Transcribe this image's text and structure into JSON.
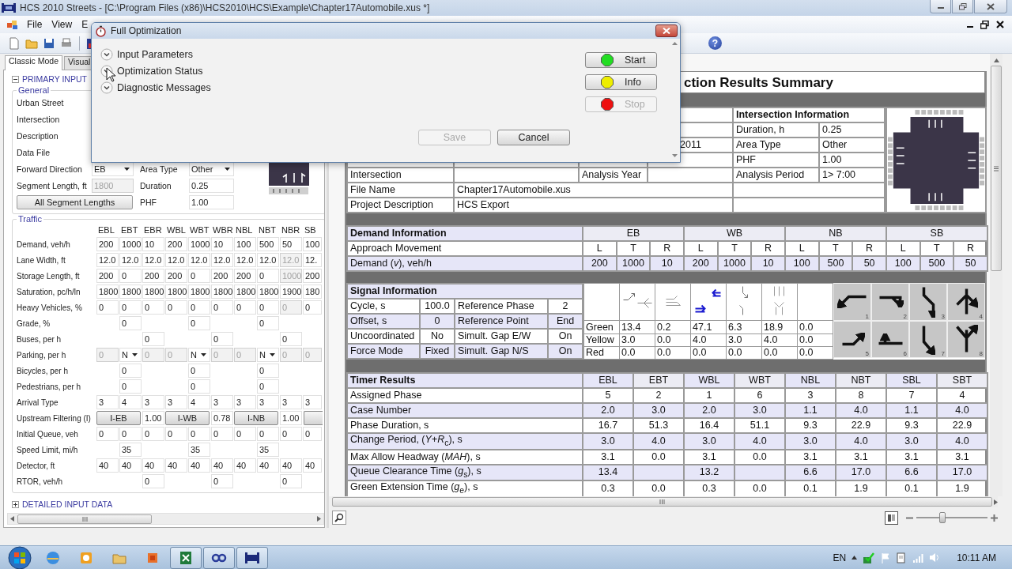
{
  "window": {
    "title": "HCS 2010 Streets - [C:\\Program Files (x86)\\HCS2010\\HCS\\Example\\Chapter17Automobile.xus *]"
  },
  "menu": [
    "File",
    "View",
    "E"
  ],
  "toolbar": {
    "help_glyph": "?"
  },
  "left_panel": {
    "tabs": [
      {
        "label": "Classic Mode",
        "selected": true
      },
      {
        "label": "Visual",
        "selected": false
      }
    ],
    "primary_input": {
      "label": "PRIMARY INPUT",
      "expanded": true
    },
    "general": {
      "legend": "General",
      "labels": [
        "Urban Street",
        "Intersection",
        "Description",
        "Data File"
      ],
      "forward_direction": {
        "label": "Forward Direction",
        "value": "EB"
      },
      "area_type": {
        "label": "Area Type",
        "value": "Other"
      },
      "segment_length": {
        "label": "Segment Length, ft",
        "value": "1800",
        "disabled": true
      },
      "duration": {
        "label": "Duration",
        "value": "0.25",
        "disabled": false
      },
      "all_segment_lengths": "All Segment Lengths",
      "phf": {
        "label": "PHF",
        "value": "1.00",
        "disabled": false
      }
    },
    "traffic": {
      "legend": "Traffic",
      "columns": [
        "EBL",
        "EBT",
        "EBR",
        "WBL",
        "WBT",
        "WBR",
        "NBL",
        "NBT",
        "NBR",
        "SB"
      ],
      "rows": [
        {
          "label": "Demand, veh/h",
          "cells": [
            {
              "kind": "input",
              "value": "200",
              "disabled": false
            },
            {
              "kind": "input",
              "value": "1000",
              "disabled": false
            },
            {
              "kind": "input",
              "value": "10",
              "disabled": false
            },
            {
              "kind": "input",
              "value": "200",
              "disabled": false
            },
            {
              "kind": "input",
              "value": "1000",
              "disabled": false
            },
            {
              "kind": "input",
              "value": "10",
              "disabled": false
            },
            {
              "kind": "input",
              "value": "100",
              "disabled": false
            },
            {
              "kind": "input",
              "value": "500",
              "disabled": false
            },
            {
              "kind": "input",
              "value": "50",
              "disabled": false
            },
            {
              "kind": "input",
              "value": "100",
              "disabled": false
            }
          ]
        },
        {
          "label": "Lane Width, ft",
          "cells": [
            {
              "kind": "input",
              "value": "12.0",
              "disabled": false
            },
            {
              "kind": "input",
              "value": "12.0",
              "disabled": false
            },
            {
              "kind": "input",
              "value": "12.0",
              "disabled": false
            },
            {
              "kind": "input",
              "value": "12.0",
              "disabled": false
            },
            {
              "kind": "input",
              "value": "12.0",
              "disabled": false
            },
            {
              "kind": "input",
              "value": "12.0",
              "disabled": false
            },
            {
              "kind": "input",
              "value": "12.0",
              "disabled": false
            },
            {
              "kind": "input",
              "value": "12.0",
              "disabled": false
            },
            {
              "kind": "input",
              "value": "12.0",
              "disabled": true
            },
            {
              "kind": "input",
              "value": "12.",
              "disabled": false
            }
          ]
        },
        {
          "label": "Storage Length, ft",
          "cells": [
            {
              "kind": "input",
              "value": "200",
              "disabled": false
            },
            {
              "kind": "input",
              "value": "0",
              "disabled": false
            },
            {
              "kind": "input",
              "value": "200",
              "disabled": false
            },
            {
              "kind": "input",
              "value": "200",
              "disabled": false
            },
            {
              "kind": "input",
              "value": "0",
              "disabled": false
            },
            {
              "kind": "input",
              "value": "200",
              "disabled": false
            },
            {
              "kind": "input",
              "value": "200",
              "disabled": false
            },
            {
              "kind": "input",
              "value": "0",
              "disabled": false
            },
            {
              "kind": "input",
              "value": "1000",
              "disabled": true
            },
            {
              "kind": "input",
              "value": "200",
              "disabled": false
            }
          ]
        },
        {
          "label": "Saturation, pc/h/ln",
          "cells": [
            {
              "kind": "input",
              "value": "1800",
              "disabled": false
            },
            {
              "kind": "input",
              "value": "1800",
              "disabled": false
            },
            {
              "kind": "input",
              "value": "1800",
              "disabled": false
            },
            {
              "kind": "input",
              "value": "1800",
              "disabled": false
            },
            {
              "kind": "input",
              "value": "1800",
              "disabled": false
            },
            {
              "kind": "input",
              "value": "1800",
              "disabled": false
            },
            {
              "kind": "input",
              "value": "1800",
              "disabled": false
            },
            {
              "kind": "input",
              "value": "1800",
              "disabled": false
            },
            {
              "kind": "input",
              "value": "1900",
              "disabled": false
            },
            {
              "kind": "input",
              "value": "180",
              "disabled": false
            }
          ]
        },
        {
          "label": "Heavy Vehicles, %",
          "cells": [
            {
              "kind": "input",
              "value": "0",
              "disabled": false
            },
            {
              "kind": "input",
              "value": "0",
              "disabled": false
            },
            {
              "kind": "input",
              "value": "0",
              "disabled": false
            },
            {
              "kind": "input",
              "value": "0",
              "disabled": false
            },
            {
              "kind": "input",
              "value": "0",
              "disabled": false
            },
            {
              "kind": "input",
              "value": "0",
              "disabled": false
            },
            {
              "kind": "input",
              "value": "0",
              "disabled": false
            },
            {
              "kind": "input",
              "value": "0",
              "disabled": false
            },
            {
              "kind": "input",
              "value": "0",
              "disabled": true
            },
            {
              "kind": "input",
              "value": "0",
              "disabled": false
            }
          ]
        },
        {
          "label": "Grade, %",
          "cells": [
            {
              "kind": "empty"
            },
            {
              "kind": "input",
              "value": "0",
              "disabled": false
            },
            {
              "kind": "empty"
            },
            {
              "kind": "empty"
            },
            {
              "kind": "input",
              "value": "0",
              "disabled": false
            },
            {
              "kind": "empty"
            },
            {
              "kind": "empty"
            },
            {
              "kind": "input",
              "value": "0",
              "disabled": false
            },
            {
              "kind": "empty"
            },
            {
              "kind": "empty"
            }
          ]
        },
        {
          "label": "Buses, per h",
          "cells": [
            {
              "kind": "empty"
            },
            {
              "kind": "empty"
            },
            {
              "kind": "input",
              "value": "0",
              "disabled": false
            },
            {
              "kind": "empty"
            },
            {
              "kind": "empty"
            },
            {
              "kind": "input",
              "value": "0",
              "disabled": false
            },
            {
              "kind": "empty"
            },
            {
              "kind": "empty"
            },
            {
              "kind": "input",
              "value": "0",
              "disabled": false
            },
            {
              "kind": "empty"
            }
          ]
        },
        {
          "label": "Parking, per h",
          "cells": [
            {
              "kind": "input",
              "value": "0",
              "disabled": true
            },
            {
              "kind": "dropdown",
              "value": "N"
            },
            {
              "kind": "input",
              "value": "0",
              "disabled": true
            },
            {
              "kind": "input",
              "value": "0",
              "disabled": true
            },
            {
              "kind": "dropdown",
              "value": "N"
            },
            {
              "kind": "input",
              "value": "0",
              "disabled": true
            },
            {
              "kind": "input",
              "value": "0",
              "disabled": true
            },
            {
              "kind": "dropdown",
              "value": "N"
            },
            {
              "kind": "input",
              "value": "0",
              "disabled": true
            },
            {
              "kind": "input",
              "value": "0",
              "disabled": true
            }
          ]
        },
        {
          "label": "Bicycles, per h",
          "cells": [
            {
              "kind": "empty"
            },
            {
              "kind": "input",
              "value": "0",
              "disabled": false
            },
            {
              "kind": "empty"
            },
            {
              "kind": "empty"
            },
            {
              "kind": "input",
              "value": "0",
              "disabled": false
            },
            {
              "kind": "empty"
            },
            {
              "kind": "empty"
            },
            {
              "kind": "input",
              "value": "0",
              "disabled": false
            },
            {
              "kind": "empty"
            },
            {
              "kind": "empty"
            }
          ]
        },
        {
          "label": "Pedestrians, per h",
          "cells": [
            {
              "kind": "empty"
            },
            {
              "kind": "input",
              "value": "0",
              "disabled": false
            },
            {
              "kind": "empty"
            },
            {
              "kind": "empty"
            },
            {
              "kind": "input",
              "value": "0",
              "disabled": false
            },
            {
              "kind": "empty"
            },
            {
              "kind": "empty"
            },
            {
              "kind": "input",
              "value": "0",
              "disabled": false
            },
            {
              "kind": "empty"
            },
            {
              "kind": "empty"
            }
          ]
        },
        {
          "label": "Arrival Type",
          "cells": [
            {
              "kind": "input",
              "value": "3",
              "disabled": false
            },
            {
              "kind": "input",
              "value": "4",
              "disabled": false
            },
            {
              "kind": "input",
              "value": "3",
              "disabled": false
            },
            {
              "kind": "input",
              "value": "3",
              "disabled": false
            },
            {
              "kind": "input",
              "value": "4",
              "disabled": false
            },
            {
              "kind": "input",
              "value": "3",
              "disabled": false
            },
            {
              "kind": "input",
              "value": "3",
              "disabled": false
            },
            {
              "kind": "input",
              "value": "3",
              "disabled": false
            },
            {
              "kind": "input",
              "value": "3",
              "disabled": false
            },
            {
              "kind": "input",
              "value": "3",
              "disabled": false
            }
          ]
        },
        {
          "label": "Upstream Filtering (I)",
          "cells": [
            {
              "kind": "wide-button",
              "label": "I-EB"
            },
            {
              "kind": "merged"
            },
            {
              "kind": "input",
              "value": "1.00",
              "disabled": false
            },
            {
              "kind": "wide-button",
              "label": "I-WB"
            },
            {
              "kind": "merged"
            },
            {
              "kind": "input",
              "value": "0.78",
              "disabled": false
            },
            {
              "kind": "wide-button",
              "label": "I-NB"
            },
            {
              "kind": "merged"
            },
            {
              "kind": "input",
              "value": "1.00",
              "disabled": false
            },
            {
              "kind": "button-stub"
            }
          ]
        },
        {
          "label": "Initial Queue, veh",
          "cells": [
            {
              "kind": "input",
              "value": "0",
              "disabled": false
            },
            {
              "kind": "input",
              "value": "0",
              "disabled": false
            },
            {
              "kind": "input",
              "value": "0",
              "disabled": false
            },
            {
              "kind": "input",
              "value": "0",
              "disabled": false
            },
            {
              "kind": "input",
              "value": "0",
              "disabled": false
            },
            {
              "kind": "input",
              "value": "0",
              "disabled": false
            },
            {
              "kind": "input",
              "value": "0",
              "disabled": false
            },
            {
              "kind": "input",
              "value": "0",
              "disabled": false
            },
            {
              "kind": "input",
              "value": "0",
              "disabled": false
            },
            {
              "kind": "input",
              "value": "0",
              "disabled": false
            }
          ]
        },
        {
          "label": "Speed Limit, mi/h",
          "cells": [
            {
              "kind": "empty"
            },
            {
              "kind": "input",
              "value": "35",
              "disabled": false
            },
            {
              "kind": "empty"
            },
            {
              "kind": "empty"
            },
            {
              "kind": "input",
              "value": "35",
              "disabled": false
            },
            {
              "kind": "empty"
            },
            {
              "kind": "empty"
            },
            {
              "kind": "input",
              "value": "35",
              "disabled": false
            },
            {
              "kind": "empty"
            },
            {
              "kind": "empty"
            }
          ]
        },
        {
          "label": "Detector, ft",
          "cells": [
            {
              "kind": "input",
              "value": "40",
              "disabled": false
            },
            {
              "kind": "input",
              "value": "40",
              "disabled": false
            },
            {
              "kind": "input",
              "value": "40",
              "disabled": false
            },
            {
              "kind": "input",
              "value": "40",
              "disabled": false
            },
            {
              "kind": "input",
              "value": "40",
              "disabled": false
            },
            {
              "kind": "input",
              "value": "40",
              "disabled": false
            },
            {
              "kind": "input",
              "value": "40",
              "disabled": false
            },
            {
              "kind": "input",
              "value": "40",
              "disabled": false
            },
            {
              "kind": "input",
              "value": "40",
              "disabled": false
            },
            {
              "kind": "input",
              "value": "40",
              "disabled": false
            }
          ]
        },
        {
          "label": "RTOR, veh/h",
          "cells": [
            {
              "kind": "empty"
            },
            {
              "kind": "empty"
            },
            {
              "kind": "input",
              "value": "0",
              "disabled": false
            },
            {
              "kind": "empty"
            },
            {
              "kind": "empty"
            },
            {
              "kind": "input",
              "value": "0",
              "disabled": false
            },
            {
              "kind": "empty"
            },
            {
              "kind": "empty"
            },
            {
              "kind": "input",
              "value": "0",
              "disabled": false
            },
            {
              "kind": "empty"
            }
          ]
        }
      ]
    },
    "detailed_input": {
      "label": "DETAILED INPUT DATA",
      "expanded": false
    }
  },
  "report": {
    "title": "ction Results Summary",
    "general_information": {
      "date_fragment": "2011",
      "intersection": {
        "label": "Intersection",
        "year_label": "Analysis Year"
      },
      "file_name": {
        "label": "File Name",
        "value": "Chapter17Automobile.xus"
      },
      "project_description": {
        "label": "Project Description",
        "value": "HCS Export"
      }
    },
    "intersection_information": {
      "title": "Intersection Information",
      "rows": [
        {
          "label": "Duration, h",
          "value": "0.25"
        },
        {
          "label": "Area Type",
          "value": "Other"
        },
        {
          "label": "PHF",
          "value": "1.00"
        },
        {
          "label": "Analysis Period",
          "value": "1> 7:00"
        }
      ]
    },
    "demand_information": {
      "title": "Demand Information",
      "approaches": [
        "EB",
        "WB",
        "NB",
        "SB"
      ],
      "movement_label": "Approach Movement",
      "movements": [
        "L",
        "T",
        "R",
        "L",
        "T",
        "R",
        "L",
        "T",
        "R",
        "L",
        "T",
        "R"
      ],
      "demand_label": "Demand (*v*), veh/h",
      "demand": [
        "200",
        "1000",
        "10",
        "200",
        "1000",
        "10",
        "100",
        "500",
        "50",
        "100",
        "500",
        "50"
      ]
    },
    "signal_information": {
      "title": "Signal Information",
      "rows": [
        {
          "label": "Cycle, s",
          "value": "100.0",
          "label_2": "Reference Phase",
          "value_2": "2"
        },
        {
          "label": "Offset, s",
          "value": "0",
          "label_2": "Reference Point",
          "value_2": "End"
        },
        {
          "label": "Uncoordinated",
          "value": "No",
          "label_2": "Simult. Gap E/W",
          "value_2": "On"
        },
        {
          "label": "Force Mode",
          "value": "Fixed",
          "label_2": "Simult. Gap N/S",
          "value_2": "On"
        }
      ],
      "ring": [
        {
          "label": "Green",
          "values": [
            "13.4",
            "0.2",
            "47.1",
            "6.3",
            "18.9",
            "0.0"
          ]
        },
        {
          "label": "Yellow",
          "values": [
            "3.0",
            "0.0",
            "4.0",
            "3.0",
            "4.0",
            "0.0"
          ]
        },
        {
          "label": "Red",
          "values": [
            "0.0",
            "0.0",
            "0.0",
            "0.0",
            "0.0",
            "0.0"
          ]
        }
      ],
      "phases": [
        "1",
        "2",
        "3",
        "4",
        "5",
        "6",
        "7",
        "8"
      ]
    },
    "timer_results": {
      "title": "Timer Results",
      "columns": [
        "EBL",
        "EBT",
        "WBL",
        "WBT",
        "NBL",
        "NBT",
        "SBL",
        "SBT"
      ],
      "rows": [
        {
          "label": "Assigned Phase",
          "values": [
            "5",
            "2",
            "1",
            "6",
            "3",
            "8",
            "7",
            "4"
          ]
        },
        {
          "label": "Case Number",
          "values": [
            "2.0",
            "3.0",
            "2.0",
            "3.0",
            "1.1",
            "4.0",
            "1.1",
            "4.0"
          ]
        },
        {
          "label": "Phase Duration, s",
          "values": [
            "16.7",
            "51.3",
            "16.4",
            "51.1",
            "9.3",
            "22.9",
            "9.3",
            "22.9"
          ]
        },
        {
          "label": "Change Period, (*Y+R*$_{c}$), s",
          "values": [
            "3.0",
            "4.0",
            "3.0",
            "4.0",
            "3.0",
            "4.0",
            "3.0",
            "4.0"
          ]
        },
        {
          "label": "Max Allow Headway (*MAH*), s",
          "values": [
            "3.1",
            "0.0",
            "3.1",
            "0.0",
            "3.1",
            "3.1",
            "3.1",
            "3.1"
          ]
        },
        {
          "label": "Queue Clearance Time (*g*$_{s}$), s",
          "cells": [
            {
              "kind": "value",
              "value": "13.4"
            },
            {
              "kind": "empty"
            },
            {
              "kind": "value",
              "value": "13.2"
            },
            {
              "kind": "empty"
            },
            {
              "kind": "value",
              "value": "6.6"
            },
            {
              "kind": "value",
              "value": "17.0"
            },
            {
              "kind": "value",
              "value": "6.6"
            },
            {
              "kind": "value",
              "value": "17.0"
            }
          ]
        },
        {
          "label": "Green Extension Time (*g*$_{e}$), s",
          "values": [
            "0.3",
            "0.0",
            "0.3",
            "0.0",
            "0.1",
            "1.9",
            "0.1",
            "1.9"
          ]
        }
      ]
    }
  },
  "zoom": {
    "level": 0.37
  },
  "dialog": {
    "title": "Full Optimization",
    "sections": [
      {
        "label": "Input Parameters",
        "expanded": false
      },
      {
        "label": "Optimization Status",
        "expanded": false
      },
      {
        "label": "Diagnostic Messages",
        "expanded": false
      }
    ],
    "buttons": [
      {
        "label": "Start",
        "color": "#22dd22",
        "disabled": false
      },
      {
        "label": "Info",
        "color": "#eeee00",
        "disabled": false
      },
      {
        "label": "Stop",
        "color": "#ee1111",
        "disabled": true
      }
    ],
    "footer_buttons": [
      {
        "label": "Save",
        "disabled": true
      },
      {
        "label": "Cancel",
        "disabled": false
      }
    ]
  },
  "taskbar": {
    "apps": [
      {
        "kind": "browser",
        "open": false
      },
      {
        "kind": "mail",
        "open": false
      },
      {
        "kind": "folder",
        "open": false
      },
      {
        "kind": "media",
        "open": false
      },
      {
        "kind": "spreadsheet",
        "open": true
      },
      {
        "kind": "link",
        "open": true
      },
      {
        "kind": "traffic",
        "open": true
      }
    ],
    "language": "EN",
    "clock": "10:11 AM"
  }
}
